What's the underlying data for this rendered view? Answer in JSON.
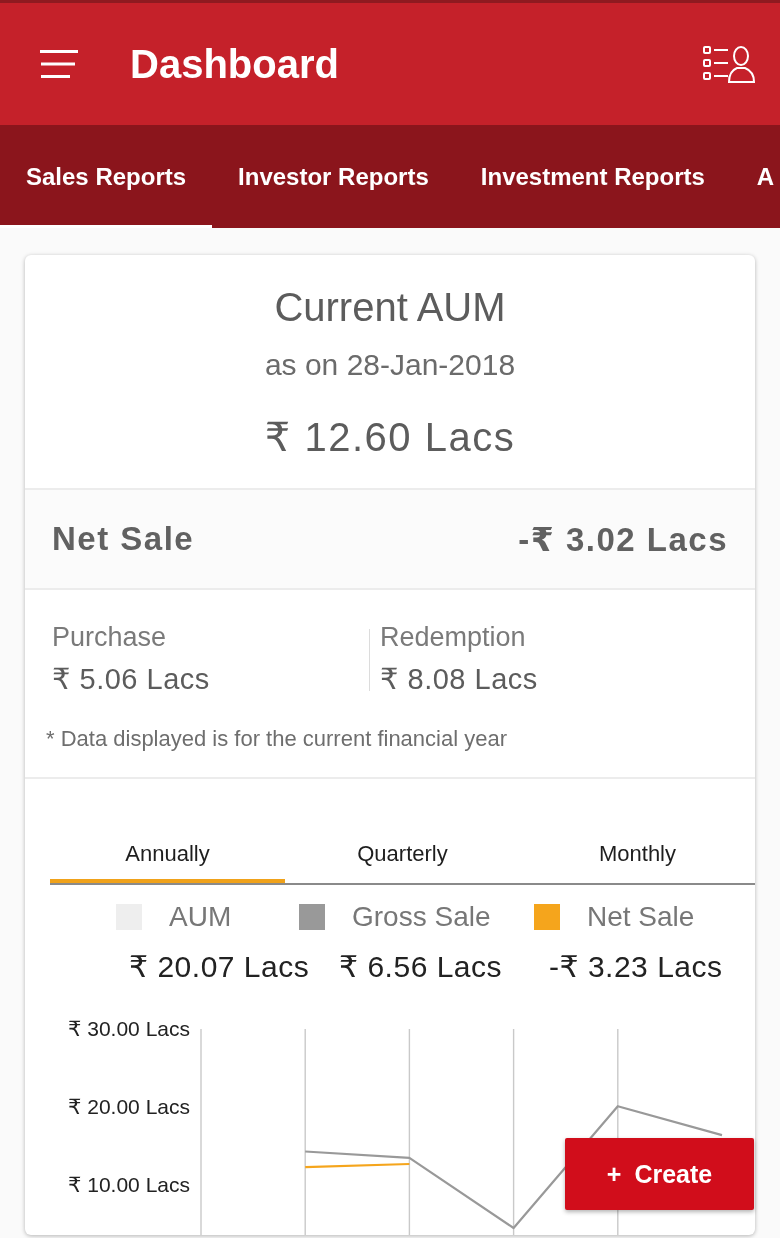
{
  "app_bar": {
    "title": "Dashboard"
  },
  "report_tabs": [
    {
      "label": "Sales Reports",
      "selected": true
    },
    {
      "label": "Investor Reports",
      "selected": false
    },
    {
      "label": "Investment Reports",
      "selected": false
    },
    {
      "label": "A",
      "selected": false
    }
  ],
  "aum": {
    "title": "Current AUM",
    "date": "as on 28-Jan-2018",
    "amount": "₹ 12.60 Lacs"
  },
  "net_sale": {
    "label": "Net Sale",
    "amount": "-₹ 3.02 Lacs"
  },
  "breakdown": [
    {
      "label": "Purchase",
      "amount": "₹ 5.06 Lacs"
    },
    {
      "label": "Redemption",
      "amount": "₹ 8.08 Lacs"
    }
  ],
  "footnote": "* Data displayed is for the current financial year",
  "chart": {
    "period_tabs": [
      {
        "label": "Annually",
        "selected": true
      },
      {
        "label": "Quarterly",
        "selected": false
      },
      {
        "label": "Monthly",
        "selected": false
      }
    ],
    "legend": [
      {
        "label": "AUM",
        "color": "#eeeeee",
        "amount": "₹ 20.07 Lacs"
      },
      {
        "label": "Gross Sale",
        "color": "#999999",
        "amount": "₹ 6.56 Lacs"
      },
      {
        "label": "Net Sale",
        "color": "#f5a51c",
        "amount": "-₹ 3.23 Lacs"
      }
    ],
    "chart_data": {
      "type": "line",
      "grid": "x",
      "ylim": [
        3.6,
        30
      ],
      "yticks": [
        {
          "value": 30,
          "label": "₹ 30.00 Lacs"
        },
        {
          "value": 20,
          "label": "₹ 20.00 Lacs"
        },
        {
          "value": 10,
          "label": "₹ 10.00 Lacs"
        }
      ],
      "series": [
        {
          "color": "#999999",
          "values": [
            null,
            14.3,
            13.5,
            4.5,
            20.1,
            16.4
          ]
        },
        {
          "color": "#f5a51c",
          "values": [
            null,
            12.3,
            12.7,
            null,
            null,
            null
          ]
        }
      ]
    }
  },
  "fab": {
    "icon": "+",
    "label": "Create"
  }
}
